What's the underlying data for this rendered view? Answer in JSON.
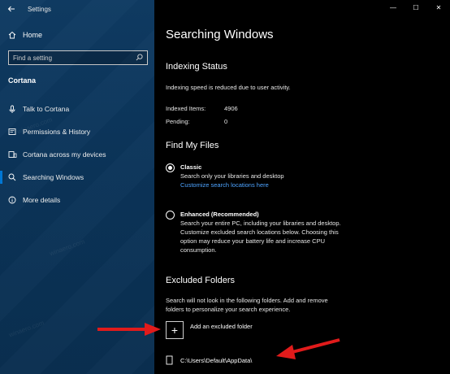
{
  "window": {
    "app_title": "Settings",
    "controls": {
      "minimize": "—",
      "maximize": "☐",
      "close": "✕"
    }
  },
  "sidebar": {
    "home_label": "Home",
    "search_placeholder": "Find a setting",
    "section_label": "Cortana",
    "items": [
      {
        "label": "Talk to Cortana",
        "icon": "microphone-icon"
      },
      {
        "label": "Permissions & History",
        "icon": "history-icon"
      },
      {
        "label": "Cortana across my devices",
        "icon": "devices-icon"
      },
      {
        "label": "Searching Windows",
        "icon": "search-icon",
        "selected": true
      },
      {
        "label": "More details",
        "icon": "info-icon"
      }
    ]
  },
  "main": {
    "title": "Searching Windows",
    "indexing": {
      "heading": "Indexing Status",
      "message": "Indexing speed is reduced due to user activity.",
      "indexed_label": "Indexed Items:",
      "indexed_value": "4906",
      "pending_label": "Pending:",
      "pending_value": "0"
    },
    "find_files": {
      "heading": "Find My Files",
      "classic": {
        "label": "Classic",
        "desc": "Search only your libraries and desktop",
        "link": "Customize search locations here",
        "selected": true
      },
      "enhanced": {
        "label": "Enhanced (Recommended)",
        "desc_lines": [
          "Search your entire PC, including your libraries and desktop.",
          "Customize excluded search locations below. Choosing this",
          "option may reduce your battery life and increase CPU",
          "consumption."
        ],
        "selected": false
      }
    },
    "excluded": {
      "heading": "Excluded Folders",
      "desc_lines": [
        "Search will not look in the following folders. Add and remove",
        "folders to personalize your search experience."
      ],
      "add_symbol": "+",
      "add_label": "Add an excluded folder",
      "folders": [
        "C:\\Users\\Default\\AppData\\"
      ]
    }
  },
  "colors": {
    "sidebar_bg": "#0b3459",
    "accent": "#0078d7",
    "link": "#4da3ff",
    "arrow": "#e11b1b"
  }
}
